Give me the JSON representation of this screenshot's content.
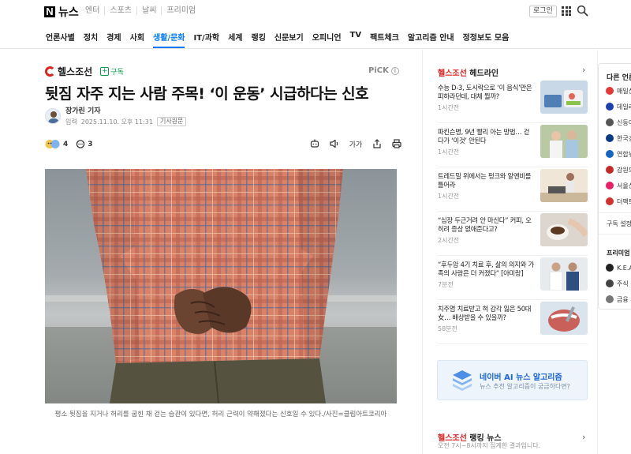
{
  "header": {
    "logo_text": "뉴스",
    "services": [
      "엔터",
      "스포츠",
      "날씨",
      "프리미엄"
    ],
    "login_label": "로그인"
  },
  "nav": {
    "items": [
      "언론사별",
      "정치",
      "경제",
      "사회",
      "생활/문화",
      "IT/과학",
      "세계",
      "랭킹",
      "신문보기",
      "오피니언",
      "TV",
      "팩트체크",
      "알고리즘 안내",
      "정정보도 모음"
    ],
    "active": "생활/문화"
  },
  "article": {
    "press": "헬스조선",
    "subscribe_label": "구독",
    "pick_label": "PiCK",
    "headline": "뒷짐 자주 지는 사람 주목! ‘이 운동’ 시급하다는 신호",
    "reporter": "장가린 기자",
    "date_label": "입력",
    "date": "2025.11.10. 오후 11:31",
    "original_label": "기사원문",
    "reaction_count": "4",
    "comment_count": "3",
    "text_size_label": "가가",
    "caption": "평소 뒷짐을 지거나 허리를 굽힌 채 걷는 습관이 있다면, 허리 근력이 약해졌다는 신호일 수 있다./사진=클립아트코리아"
  },
  "headlines": {
    "brand": "헬스조선",
    "title": "헤드라인",
    "items": [
      {
        "text": "수능 D-3, 도시락으로 ‘이 음식’만은 피하라던데, 대체 뭘까?",
        "time": "1시간전"
      },
      {
        "text": "파킨슨병, 9년 빨리 아는 방법… 걷다가 ‘이것’ 안된다",
        "time": "1시간전"
      },
      {
        "text": "트레드밀 위에서는 펑크와 알앤비를 틀어라",
        "time": "1시간전"
      },
      {
        "text": "“심장 두근거려 안 마신다” 커피, 오히려 증상 없애준다고?",
        "time": "2시간전"
      },
      {
        "text": "“후두암 4기 치료 후, 삶의 의지와 가족의 사랑은 더 커졌다” [아미랑]",
        "time": "7분전"
      },
      {
        "text": "치주염 치료받고 혀 감각 잃은 50대 女… 배상받을 수 있을까?",
        "time": "58분전"
      }
    ]
  },
  "ai_banner": {
    "title": "네이버 AI 뉴스 알고리즘",
    "subtitle": "뉴스 추천 알고리즘이 궁금하다면?"
  },
  "ranking": {
    "brand": "헬스조선",
    "title": "랭킹 뉴스",
    "subtitle": "오전 7시~8시까지 집계한 결과입니다."
  },
  "far_right": {
    "title": "다른 언론사",
    "items": [
      {
        "label": "매일신",
        "color": "#e53935"
      },
      {
        "label": "데일리",
        "color": "#1e40af"
      },
      {
        "label": "신동아",
        "color": "#555555"
      },
      {
        "label": "한국경",
        "color": "#0a3a82"
      },
      {
        "label": "연합뉴",
        "color": "#1565c0"
      },
      {
        "label": "강원도",
        "color": "#c62828"
      },
      {
        "label": "서울신",
        "color": "#e91e63"
      },
      {
        "label": "더팩트",
        "color": "#d32f2f"
      }
    ],
    "subscribe_setting": "구독 설정",
    "premium_title": "프리미엄 콘",
    "premium_items": [
      {
        "label": "K.E.A",
        "color": "#222222"
      },
      {
        "label": "주식 정",
        "color": "#444444"
      },
      {
        "label": "금융 투",
        "color": "#777777"
      }
    ]
  }
}
